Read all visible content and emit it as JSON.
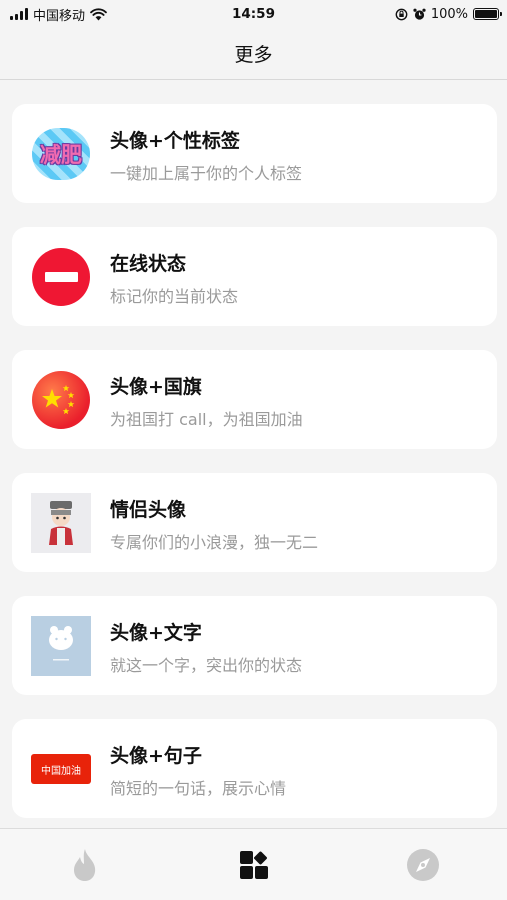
{
  "status_bar": {
    "carrier": "中国移动",
    "time": "14:59",
    "battery": "100%",
    "battery_level": 1.0
  },
  "nav": {
    "title": "更多"
  },
  "cards": [
    {
      "title": "头像+个性标签",
      "subtitle": "一键加上属于你的个人标签",
      "icon": "diet-sticker-icon",
      "icon_text": "减肥"
    },
    {
      "title": "在线状态",
      "subtitle": "标记你的当前状态",
      "icon": "do-not-disturb-icon"
    },
    {
      "title": "头像+国旗",
      "subtitle": "为祖国打 call，为祖国加油",
      "icon": "china-flag-icon"
    },
    {
      "title": "情侣头像",
      "subtitle": "专属你们的小浪漫，独一无二",
      "icon": "couple-avatar-icon"
    },
    {
      "title": "头像+文字",
      "subtitle": "就这一个字，突出你的状态",
      "icon": "text-avatar-icon"
    },
    {
      "title": "头像+句子",
      "subtitle": "简短的一句话，展示心情",
      "icon": "sentence-badge-icon",
      "icon_text": "中国加油"
    }
  ],
  "tab_bar": {
    "tabs": [
      {
        "icon": "flame-icon",
        "active": false
      },
      {
        "icon": "grid-icon",
        "active": true
      },
      {
        "icon": "compass-icon",
        "active": false
      }
    ]
  },
  "colors": {
    "background": "#f4f4f4",
    "card": "#ffffff",
    "title": "#111111",
    "subtitle": "#9a9a9a",
    "busy_red": "#ef1733",
    "flag_red": "#ea1f2c",
    "tab_inactive": "#c8c8c8",
    "tab_active": "#111111"
  }
}
